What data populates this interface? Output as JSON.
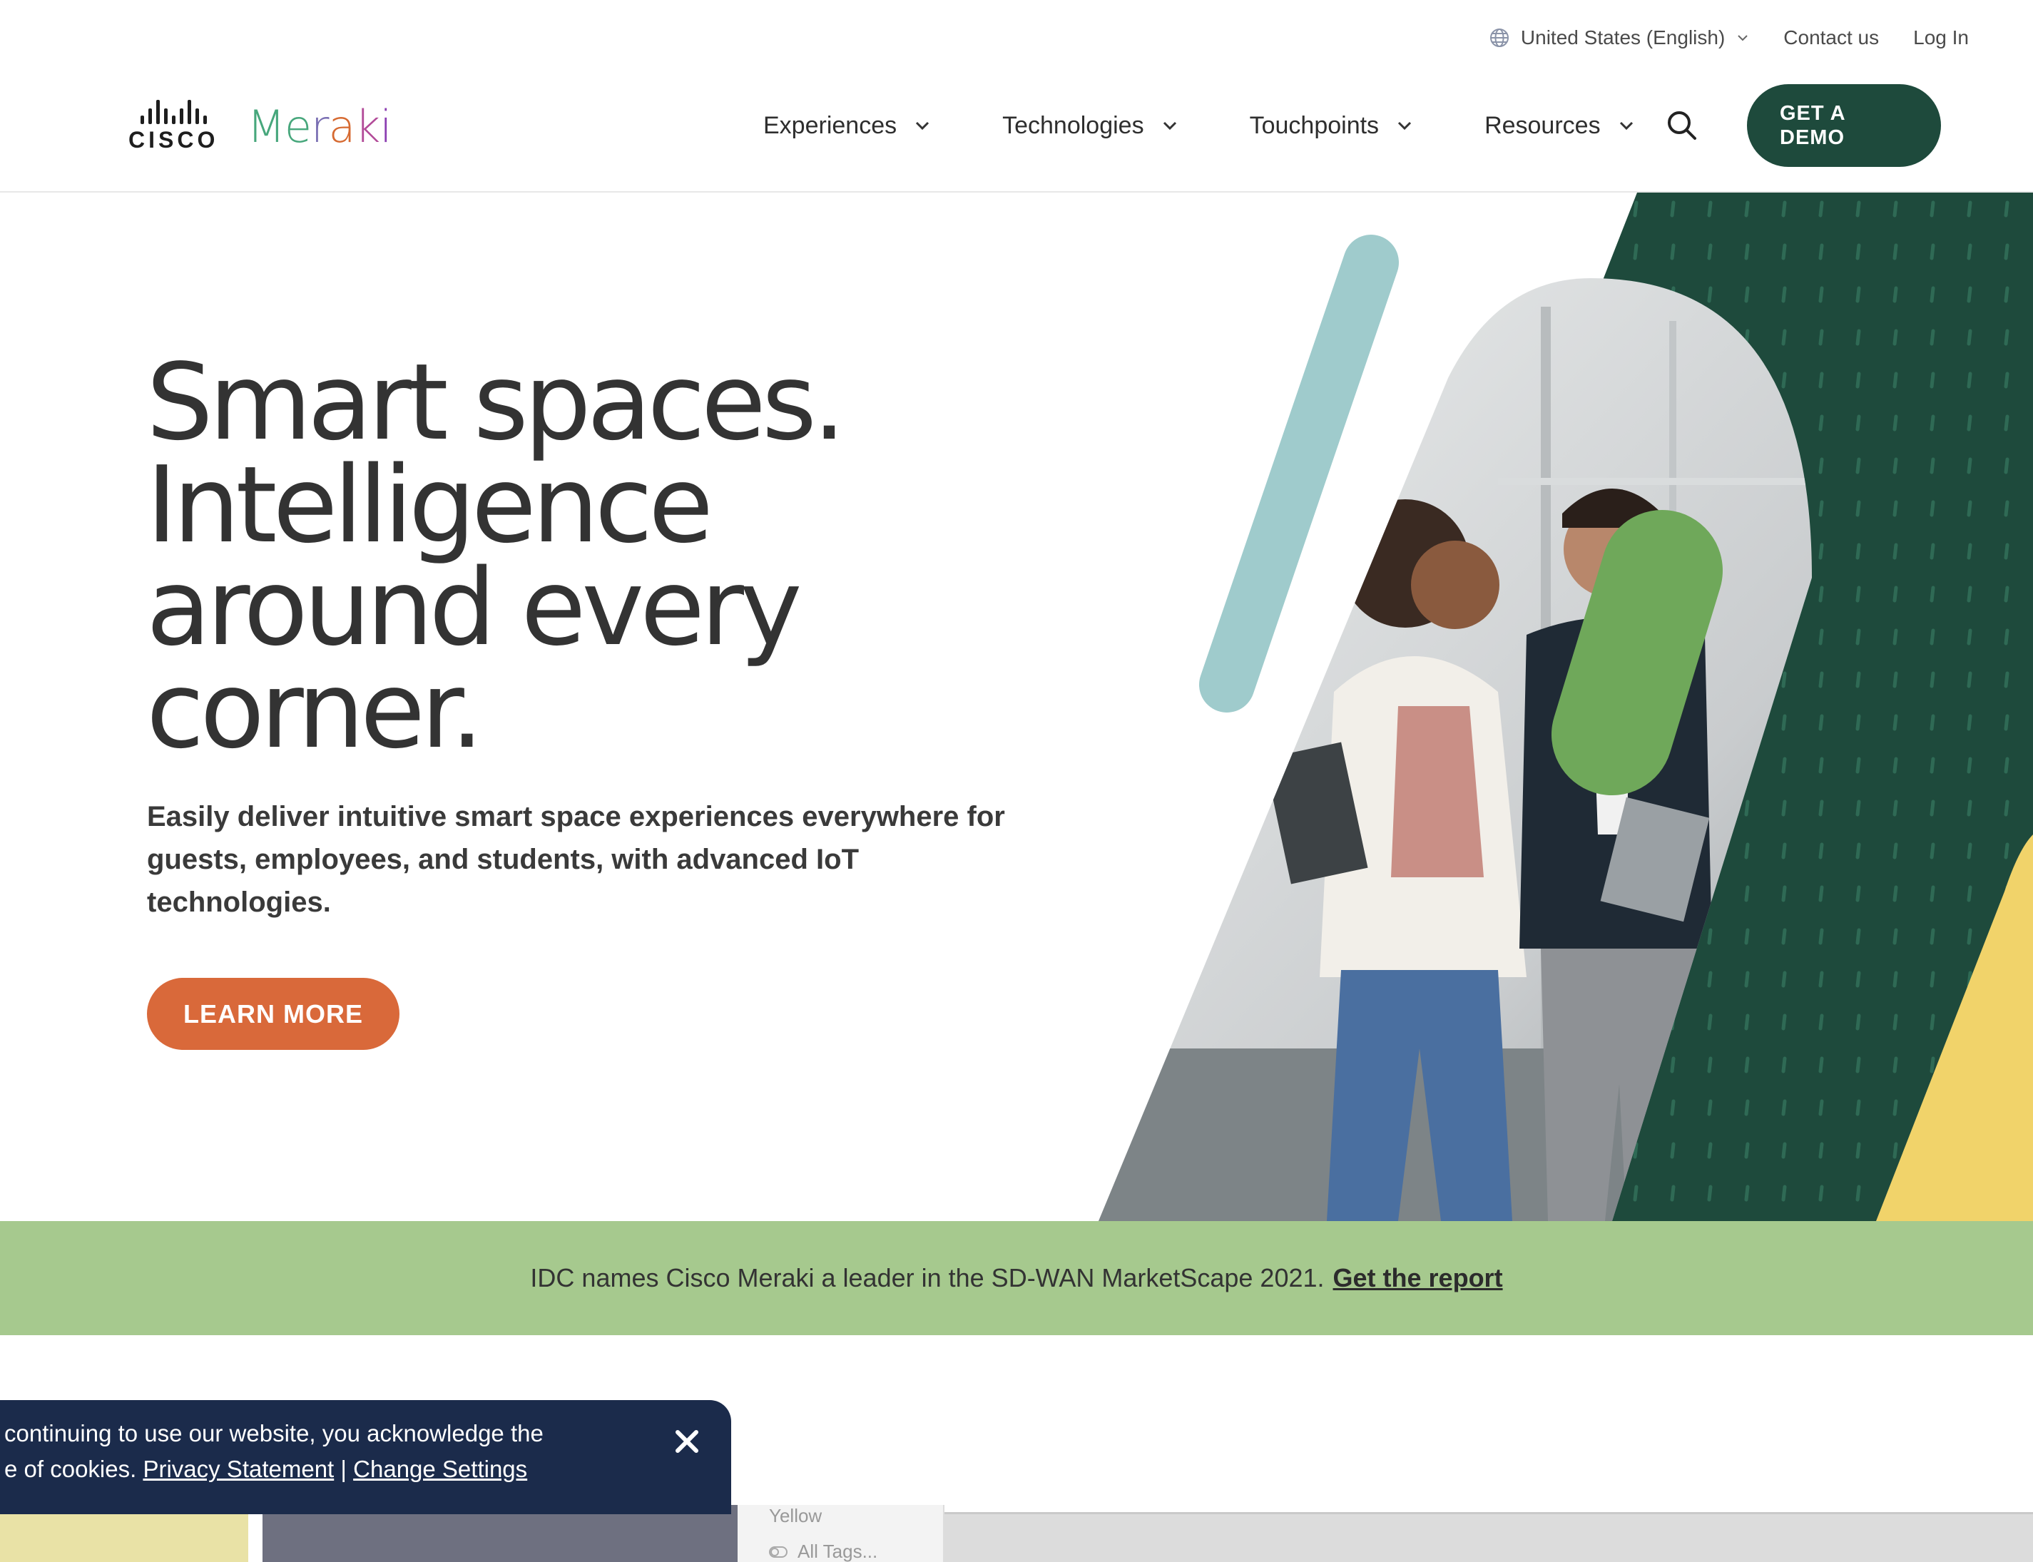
{
  "utility": {
    "locale_label": "United States (English)",
    "contact_label": "Contact us",
    "login_label": "Log In"
  },
  "logo": {
    "cisco": "CISCO",
    "meraki_parts": [
      "Me",
      "r",
      "a",
      "k",
      "i"
    ]
  },
  "nav": {
    "items": [
      {
        "label": "Experiences"
      },
      {
        "label": "Technologies"
      },
      {
        "label": "Touchpoints"
      },
      {
        "label": "Resources"
      }
    ],
    "demo_label_line1": "GET A",
    "demo_label_line2": "DEMO"
  },
  "hero": {
    "title_lines": [
      "Smart spaces.",
      "Intelligence",
      "around every",
      "corner."
    ],
    "subtitle": "Easily deliver intuitive smart space experiences everywhere for guests, employees, and students, with advanced IoT technologies.",
    "cta_label": "LEARN MORE"
  },
  "banner": {
    "text": "IDC names Cisco Meraki a leader in the SD-WAN MarketScape 2021.",
    "link_label": "Get the report"
  },
  "cookie": {
    "line1": "continuing to use our website, you acknowledge the",
    "line2_prefix": "e of cookies.",
    "privacy_label": "Privacy Statement",
    "separator": "|",
    "settings_label": "Change Settings"
  },
  "peek": {
    "tag_yellow": "Yellow",
    "tag_all": "All Tags..."
  },
  "colors": {
    "brand_dark_green": "#1e4a3c",
    "cta_orange": "#d9693a",
    "banner_green": "#a6c98e",
    "cookie_navy": "#1b2b4b",
    "accent_light_green": "#6fa85a",
    "accent_teal": "#9fcbcc",
    "accent_yellow": "#f1d36a"
  },
  "icons": [
    "globe-icon",
    "chevron-down-icon",
    "search-icon",
    "close-icon"
  ]
}
